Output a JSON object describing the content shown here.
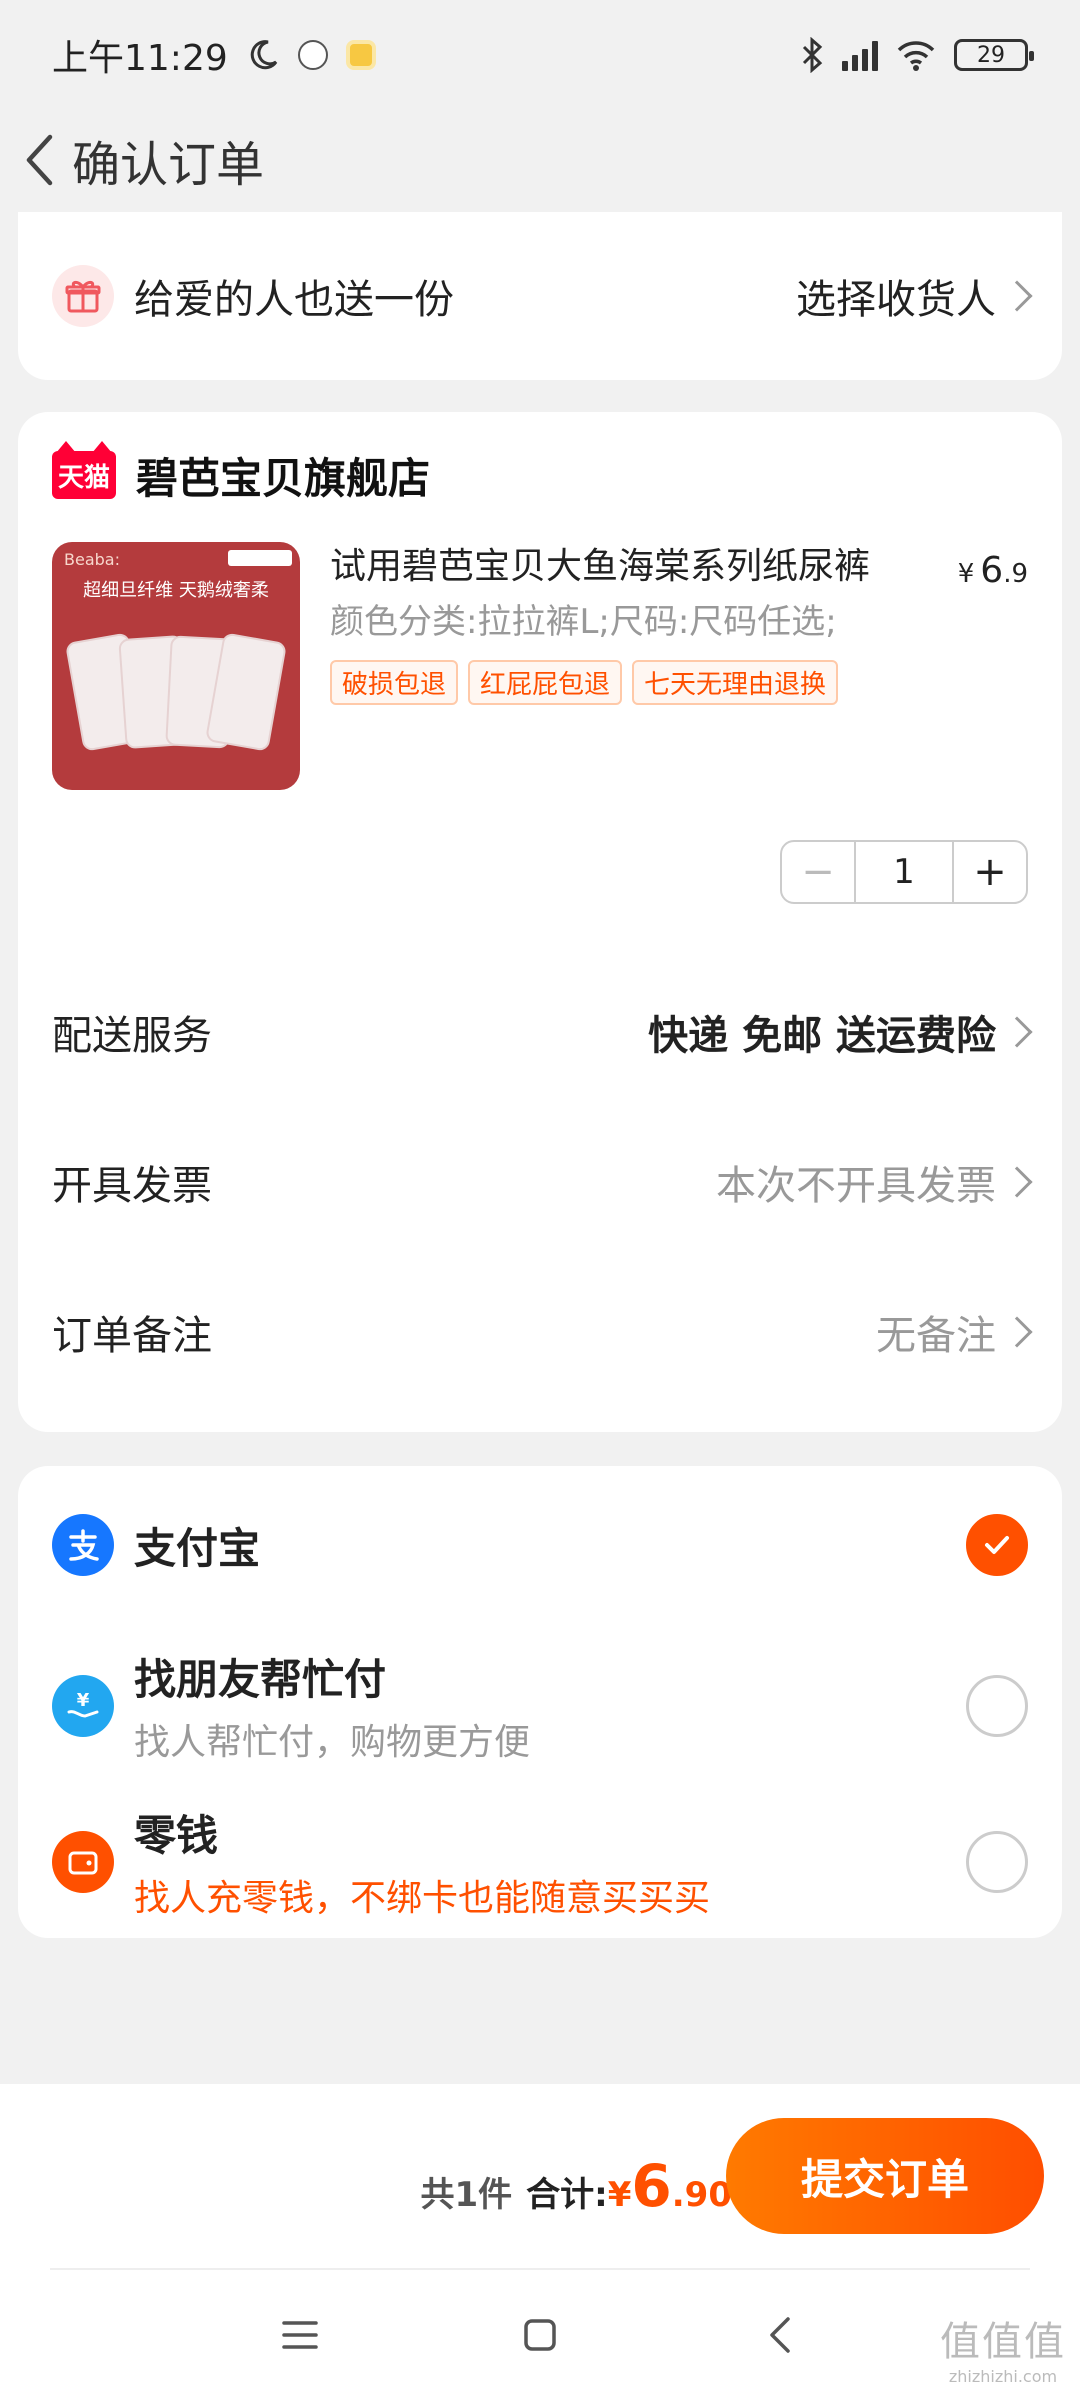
{
  "status_bar": {
    "time": "上午11:29",
    "battery": "29"
  },
  "header": {
    "title": "确认订单"
  },
  "gift": {
    "text": "给爱的人也送一份",
    "action": "选择收货人"
  },
  "shop": {
    "logo_text": "天猫",
    "name": "碧芭宝贝旗舰店",
    "product": {
      "title": "试用碧芭宝贝大鱼海棠系列纸尿裤",
      "price_symbol": "¥",
      "price_int": "6",
      "price_dec": ".9",
      "spec": "颜色分类:拉拉裤L;尺码:尺码任选;",
      "tags": [
        "破损包退",
        "红屁屁包退",
        "七天无理由退换"
      ],
      "image_brand": "Beaba:",
      "image_tagline": "超细旦纤维 天鹅绒奢柔",
      "quantity": "1"
    },
    "delivery": {
      "label": "配送服务",
      "value": "快递 免邮 送运费险"
    },
    "invoice": {
      "label": "开具发票",
      "value": "本次不开具发票"
    },
    "remark": {
      "label": "订单备注",
      "value": "无备注"
    }
  },
  "payment": {
    "methods": [
      {
        "name": "支付宝",
        "sub": "",
        "icon": "alipay-icon",
        "checked": true
      },
      {
        "name": "找朋友帮忙付",
        "sub": "找人帮忙付，购物更方便",
        "icon": "friend-pay-icon",
        "checked": false
      },
      {
        "name": "零钱",
        "sub": "找人充零钱，不绑卡也能随意买买买",
        "icon": "wallet-icon",
        "checked": false
      }
    ]
  },
  "footer": {
    "count": "共1件",
    "total_label": "合计:",
    "total_symbol": "¥",
    "total_int": "6",
    "total_dec": ".90",
    "submit": "提交订单"
  },
  "watermark": {
    "big": "值值值",
    "small": "zhizhizhi.com"
  },
  "colors": {
    "accent": "#ff5000",
    "tmall": "#ff0036",
    "alipay": "#1677ff"
  }
}
